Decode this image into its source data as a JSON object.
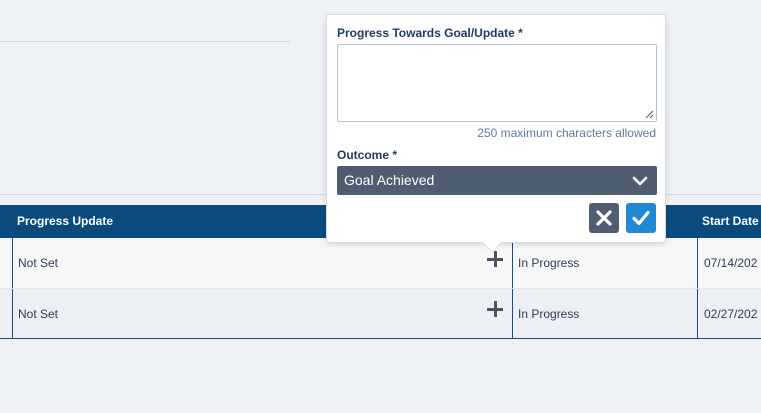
{
  "popover": {
    "progress_label": "Progress Towards Goal/Update *",
    "progress_value": "",
    "char_hint": "250 maximum characters allowed",
    "outcome_label": "Outcome *",
    "outcome_selected": "Goal Achieved",
    "cancel_icon": "x-icon",
    "confirm_icon": "check-icon"
  },
  "grid": {
    "columns": [
      "Progress Update",
      "",
      "Start Date"
    ],
    "rows": [
      {
        "progress_update": "Not Set",
        "status": "In Progress",
        "start_date": "07/14/202"
      },
      {
        "progress_update": "Not Set",
        "status": "In Progress",
        "start_date": "02/27/202"
      }
    ]
  },
  "colors": {
    "header_bg": "#0a4a7d",
    "select_bg": "#4f5d70",
    "confirm_bg": "#1e8ad6",
    "cancel_bg": "#4f5d70"
  }
}
